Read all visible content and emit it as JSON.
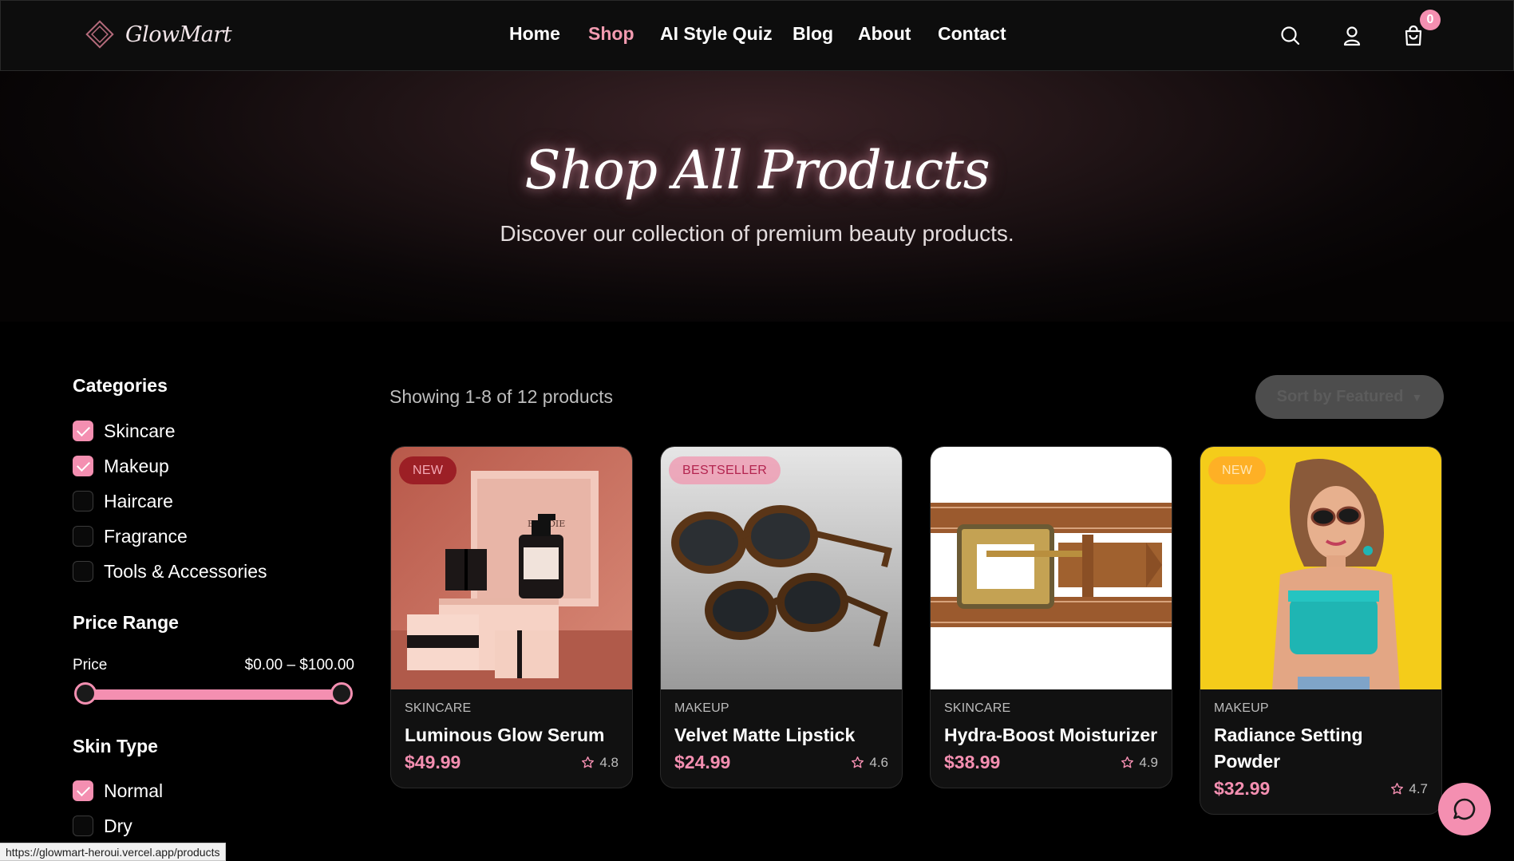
{
  "brand": {
    "name": "GlowMart",
    "logo_icon": "diamond-logo-icon",
    "accent": "#f48fb1"
  },
  "nav": {
    "items": [
      {
        "label": "Home",
        "active": false
      },
      {
        "label": "Shop",
        "active": true
      },
      {
        "label": "AI Style Quiz",
        "active": false
      },
      {
        "label": "Blog",
        "active": false
      },
      {
        "label": "About",
        "active": false
      },
      {
        "label": "Contact",
        "active": false
      }
    ],
    "icons": [
      "search-icon",
      "user-icon",
      "shopping-bag-icon"
    ],
    "cart_count": "0"
  },
  "hero": {
    "title": "Shop All Products",
    "subtitle": "Discover our collection of premium beauty products."
  },
  "sidebar": {
    "categories_heading": "Categories",
    "categories": [
      {
        "label": "Skincare",
        "checked": true
      },
      {
        "label": "Makeup",
        "checked": true
      },
      {
        "label": "Haircare",
        "checked": false
      },
      {
        "label": "Fragrance",
        "checked": false
      },
      {
        "label": "Tools & Accessories",
        "checked": false
      }
    ],
    "price_heading": "Price Range",
    "price_label": "Price",
    "price_value": "$0.00 – $100.00",
    "price_min": 0,
    "price_max": 100,
    "skin_heading": "Skin Type",
    "skin_types": [
      {
        "label": "Normal",
        "checked": true
      },
      {
        "label": "Dry",
        "checked": false
      }
    ]
  },
  "main": {
    "showing_text": "Showing 1-8 of 12 products",
    "sort_label": "Sort by Featured"
  },
  "products": [
    {
      "badge": "NEW",
      "category": "SKINCARE",
      "name": "Luminous Glow Serum",
      "price": "$49.99",
      "rating": "4.8",
      "image": "skincare-gift-boxes-photo"
    },
    {
      "badge": "BESTSELLER",
      "category": "MAKEUP",
      "name": "Velvet Matte Lipstick",
      "price": "$24.99",
      "rating": "4.6",
      "image": "tortoiseshell-sunglasses-photo"
    },
    {
      "badge": "",
      "category": "SKINCARE",
      "name": "Hydra-Boost Moisturizer",
      "price": "$38.99",
      "rating": "4.9",
      "image": "leather-belt-buckle-photo"
    },
    {
      "badge": "NEW",
      "category": "MAKEUP",
      "name": "Radiance Setting Powder",
      "price": "$32.99",
      "rating": "4.7",
      "image": "woman-sunglasses-yellow-wall-photo"
    }
  ],
  "chat": {
    "icon": "chat-bubble-icon"
  },
  "status_url": "https://glowmart-heroui.vercel.app/products"
}
